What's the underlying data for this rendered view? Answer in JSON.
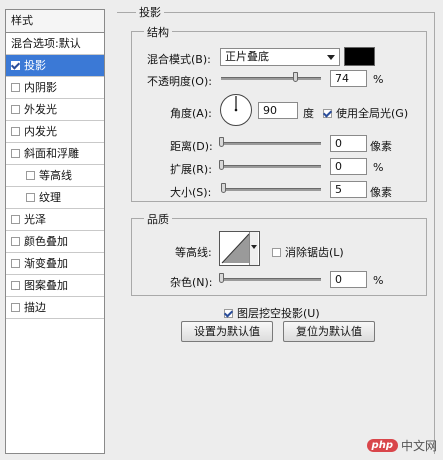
{
  "styles_panel": {
    "header": "样式",
    "blend_default": "混合选项:默认",
    "items": [
      {
        "label": "投影",
        "checked": true,
        "selected": true,
        "indent": false
      },
      {
        "label": "内阴影",
        "checked": false,
        "selected": false,
        "indent": false
      },
      {
        "label": "外发光",
        "checked": false,
        "selected": false,
        "indent": false
      },
      {
        "label": "内发光",
        "checked": false,
        "selected": false,
        "indent": false
      },
      {
        "label": "斜面和浮雕",
        "checked": false,
        "selected": false,
        "indent": false
      },
      {
        "label": "等高线",
        "checked": false,
        "selected": false,
        "indent": true
      },
      {
        "label": "纹理",
        "checked": false,
        "selected": false,
        "indent": true
      },
      {
        "label": "光泽",
        "checked": false,
        "selected": false,
        "indent": false
      },
      {
        "label": "颜色叠加",
        "checked": false,
        "selected": false,
        "indent": false
      },
      {
        "label": "渐变叠加",
        "checked": false,
        "selected": false,
        "indent": false
      },
      {
        "label": "图案叠加",
        "checked": false,
        "selected": false,
        "indent": false
      },
      {
        "label": "描边",
        "checked": false,
        "selected": false,
        "indent": false
      }
    ]
  },
  "drop_shadow": {
    "title": "投影",
    "structure": {
      "title": "结构",
      "blend_mode_label": "混合模式(B):",
      "blend_mode_value": "正片叠底",
      "shadow_color": "#000000",
      "opacity_label": "不透明度(O):",
      "opacity_value": "74",
      "opacity_unit": "%",
      "opacity_fraction": 0.74,
      "angle_label": "角度(A):",
      "angle_value": "90",
      "angle_unit": "度",
      "global_light_label": "使用全局光(G)",
      "global_light_checked": true,
      "distance_label": "距离(D):",
      "distance_value": "0",
      "distance_unit": "像素",
      "distance_fraction": 0.0,
      "spread_label": "扩展(R):",
      "spread_value": "0",
      "spread_unit": "%",
      "spread_fraction": 0.0,
      "size_label": "大小(S):",
      "size_value": "5",
      "size_unit": "像素",
      "size_fraction": 0.02
    },
    "quality": {
      "title": "品质",
      "contour_label": "等高线:",
      "antialias_label": "消除锯齿(L)",
      "antialias_checked": false,
      "noise_label": "杂色(N):",
      "noise_value": "0",
      "noise_unit": "%",
      "noise_fraction": 0.0
    },
    "knockout_label": "图层挖空投影(U)",
    "knockout_checked": true,
    "make_default_label": "设置为默认值",
    "reset_default_label": "复位为默认值"
  },
  "watermark": {
    "badge": "php",
    "site": "中文网"
  }
}
